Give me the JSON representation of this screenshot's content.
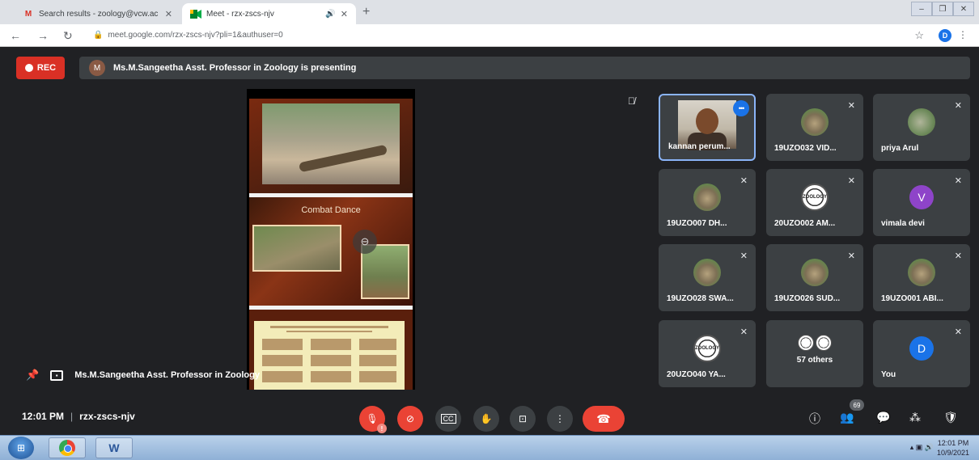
{
  "browser": {
    "tabs": [
      {
        "label": "Search results - zoology@vcw.ac",
        "icon": "gmail-icon"
      },
      {
        "label": "Meet - rzx-zscs-njv",
        "icon": "meet-icon"
      }
    ],
    "url": "meet.google.com/rzx-zscs-njv?pli=1&authuser=0",
    "profile_initial": "D"
  },
  "meet": {
    "rec_label": "REC",
    "presenter_initial": "M",
    "presenting_text": "Ms.M.Sangeetha Asst. Professor in Zoology is presenting",
    "presenter_pin_label": "Ms.M.Sangeetha Asst. Professor in Zoology",
    "slide_title": "Combat Dance",
    "participants": [
      {
        "name": "kannan perum...",
        "type": "video"
      },
      {
        "name": "19UZO032 VID...",
        "type": "photo"
      },
      {
        "name": "priya Arul",
        "type": "leaf"
      },
      {
        "name": "19UZO007 DH...",
        "type": "photo"
      },
      {
        "name": "20UZO002 AM...",
        "type": "stamp"
      },
      {
        "name": "vimala devi",
        "type": "letter",
        "initial": "V"
      },
      {
        "name": "19UZO028 SWA...",
        "type": "photo"
      },
      {
        "name": "19UZO026 SUD...",
        "type": "photo"
      },
      {
        "name": "19UZO001 ABI...",
        "type": "photo"
      },
      {
        "name": "20UZO040 YA...",
        "type": "stamp"
      },
      {
        "name": "57 others",
        "type": "others"
      },
      {
        "name": "You",
        "type": "letter",
        "initial": "D"
      }
    ],
    "stamp_text": "ZOOLOGY",
    "time": "12:01 PM",
    "meeting_code": "rzx-zscs-njv",
    "participant_count": "69",
    "mic_badge": "!"
  },
  "taskbar": {
    "clock_time": "12:01 PM",
    "clock_date": "10/9/2021"
  },
  "colors": {
    "accent": "#1a73e8",
    "danger": "#ea4335",
    "tile_bg": "#3c4043",
    "page_bg": "#202124"
  }
}
